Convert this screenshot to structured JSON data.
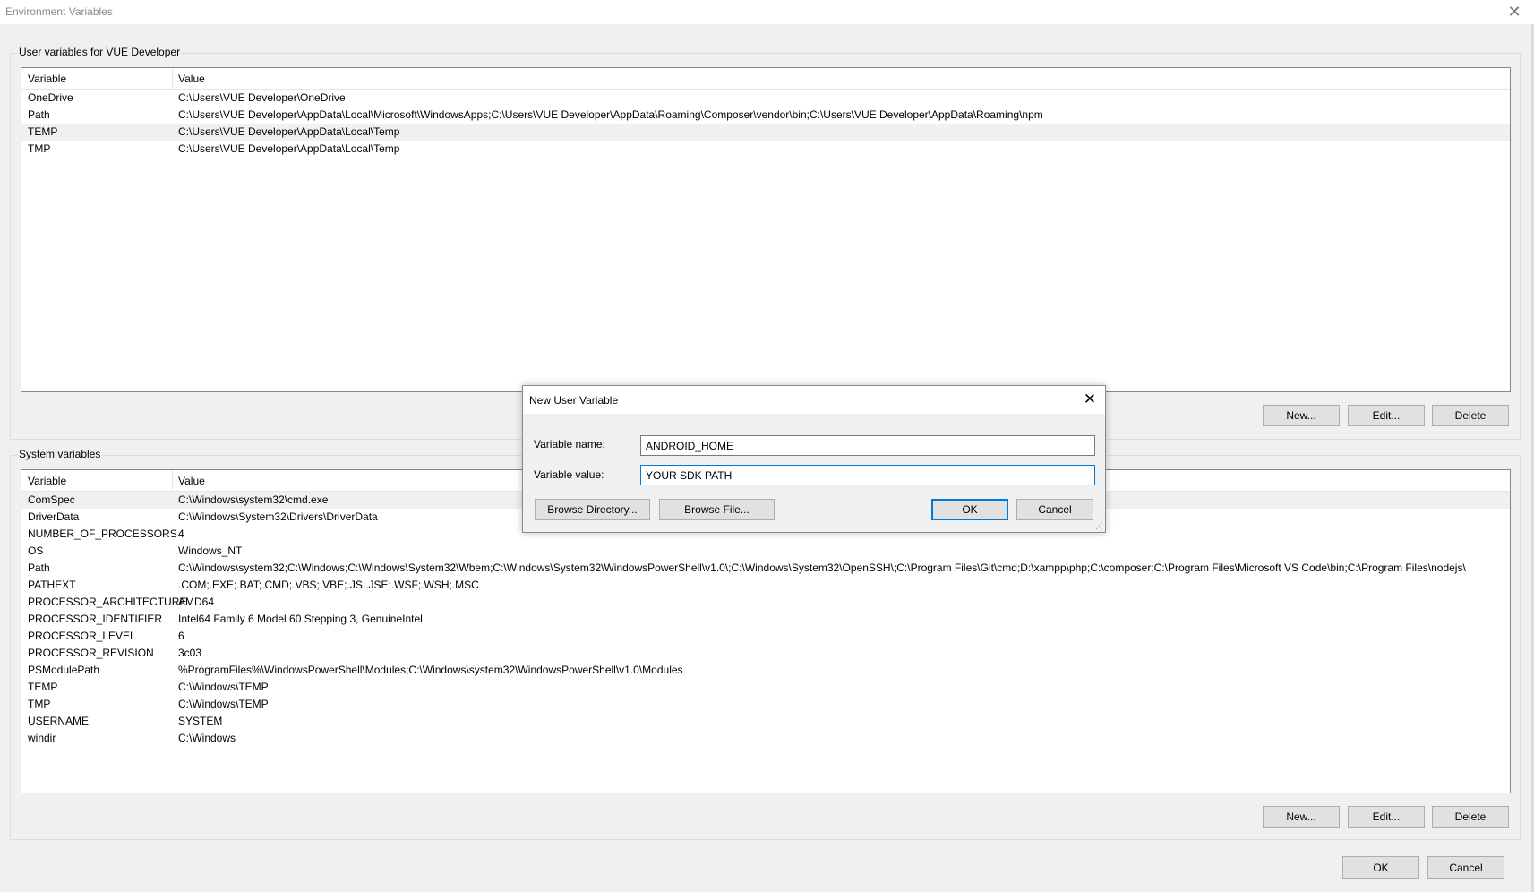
{
  "window": {
    "title": "Environment Variables",
    "close_glyph": "✕"
  },
  "user_vars": {
    "legend": "User variables for VUE Developer",
    "header_variable": "Variable",
    "header_value": "Value",
    "rows": [
      {
        "name": "OneDrive",
        "value": "C:\\Users\\VUE Developer\\OneDrive"
      },
      {
        "name": "Path",
        "value": "C:\\Users\\VUE Developer\\AppData\\Local\\Microsoft\\WindowsApps;C:\\Users\\VUE Developer\\AppData\\Roaming\\Composer\\vendor\\bin;C:\\Users\\VUE Developer\\AppData\\Roaming\\npm"
      },
      {
        "name": "TEMP",
        "value": "C:\\Users\\VUE Developer\\AppData\\Local\\Temp"
      },
      {
        "name": "TMP",
        "value": "C:\\Users\\VUE Developer\\AppData\\Local\\Temp"
      }
    ],
    "selected_row": 2,
    "new_label": "New...",
    "edit_label": "Edit...",
    "delete_label": "Delete"
  },
  "system_vars": {
    "legend": "System variables",
    "header_variable": "Variable",
    "header_value": "Value",
    "rows": [
      {
        "name": "ComSpec",
        "value": "C:\\Windows\\system32\\cmd.exe"
      },
      {
        "name": "DriverData",
        "value": "C:\\Windows\\System32\\Drivers\\DriverData"
      },
      {
        "name": "NUMBER_OF_PROCESSORS",
        "value": "4"
      },
      {
        "name": "OS",
        "value": "Windows_NT"
      },
      {
        "name": "Path",
        "value": "C:\\Windows\\system32;C:\\Windows;C:\\Windows\\System32\\Wbem;C:\\Windows\\System32\\WindowsPowerShell\\v1.0\\;C:\\Windows\\System32\\OpenSSH\\;C:\\Program Files\\Git\\cmd;D:\\xampp\\php;C:\\composer;C:\\Program Files\\Microsoft VS Code\\bin;C:\\Program Files\\nodejs\\"
      },
      {
        "name": "PATHEXT",
        "value": ".COM;.EXE;.BAT;.CMD;.VBS;.VBE;.JS;.JSE;.WSF;.WSH;.MSC"
      },
      {
        "name": "PROCESSOR_ARCHITECTURE",
        "value": "AMD64"
      },
      {
        "name": "PROCESSOR_IDENTIFIER",
        "value": "Intel64 Family 6 Model 60 Stepping 3, GenuineIntel"
      },
      {
        "name": "PROCESSOR_LEVEL",
        "value": "6"
      },
      {
        "name": "PROCESSOR_REVISION",
        "value": "3c03"
      },
      {
        "name": "PSModulePath",
        "value": "%ProgramFiles%\\WindowsPowerShell\\Modules;C:\\Windows\\system32\\WindowsPowerShell\\v1.0\\Modules"
      },
      {
        "name": "TEMP",
        "value": "C:\\Windows\\TEMP"
      },
      {
        "name": "TMP",
        "value": "C:\\Windows\\TEMP"
      },
      {
        "name": "USERNAME",
        "value": "SYSTEM"
      },
      {
        "name": "windir",
        "value": "C:\\Windows"
      }
    ],
    "selected_row": 0,
    "new_label": "New...",
    "edit_label": "Edit...",
    "delete_label": "Delete"
  },
  "footer": {
    "ok_label": "OK",
    "cancel_label": "Cancel"
  },
  "dialog": {
    "title": "New User Variable",
    "close_glyph": "✕",
    "name_label": "Variable name:",
    "name_value": "ANDROID_HOME",
    "value_label": "Variable value:",
    "value_value": "YOUR SDK PATH",
    "browse_dir_label": "Browse Directory...",
    "browse_file_label": "Browse File...",
    "ok_label": "OK",
    "cancel_label": "Cancel",
    "grip_glyph": "⋰"
  },
  "colors": {
    "accent": "#0078d7",
    "window_bg": "#f0f0f0",
    "list_border": "#828790"
  }
}
